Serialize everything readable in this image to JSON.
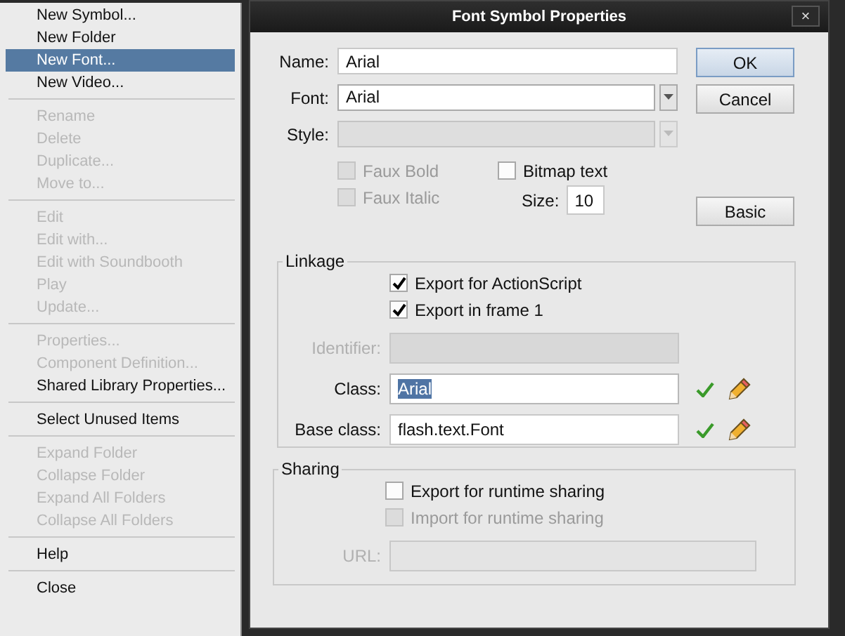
{
  "menu": {
    "items": [
      {
        "kind": "item",
        "label": "New Symbol...",
        "disabled": false,
        "selected": false
      },
      {
        "kind": "item",
        "label": "New Folder",
        "disabled": false,
        "selected": false
      },
      {
        "kind": "item",
        "label": "New Font...",
        "disabled": false,
        "selected": true
      },
      {
        "kind": "item",
        "label": "New Video...",
        "disabled": false,
        "selected": false
      },
      {
        "kind": "separator"
      },
      {
        "kind": "item",
        "label": "Rename",
        "disabled": true,
        "selected": false
      },
      {
        "kind": "item",
        "label": "Delete",
        "disabled": true,
        "selected": false
      },
      {
        "kind": "item",
        "label": "Duplicate...",
        "disabled": true,
        "selected": false
      },
      {
        "kind": "item",
        "label": "Move to...",
        "disabled": true,
        "selected": false
      },
      {
        "kind": "separator"
      },
      {
        "kind": "item",
        "label": "Edit",
        "disabled": true,
        "selected": false
      },
      {
        "kind": "item",
        "label": "Edit with...",
        "disabled": true,
        "selected": false
      },
      {
        "kind": "item",
        "label": "Edit with Soundbooth",
        "disabled": true,
        "selected": false
      },
      {
        "kind": "item",
        "label": "Play",
        "disabled": true,
        "selected": false
      },
      {
        "kind": "item",
        "label": "Update...",
        "disabled": true,
        "selected": false
      },
      {
        "kind": "separator"
      },
      {
        "kind": "item",
        "label": "Properties...",
        "disabled": true,
        "selected": false
      },
      {
        "kind": "item",
        "label": "Component Definition...",
        "disabled": true,
        "selected": false
      },
      {
        "kind": "item",
        "label": "Shared Library Properties...",
        "disabled": false,
        "selected": false
      },
      {
        "kind": "separator"
      },
      {
        "kind": "item",
        "label": "Select Unused Items",
        "disabled": false,
        "selected": false
      },
      {
        "kind": "separator"
      },
      {
        "kind": "item",
        "label": "Expand Folder",
        "disabled": true,
        "selected": false
      },
      {
        "kind": "item",
        "label": "Collapse Folder",
        "disabled": true,
        "selected": false
      },
      {
        "kind": "item",
        "label": "Expand All Folders",
        "disabled": true,
        "selected": false
      },
      {
        "kind": "item",
        "label": "Collapse All Folders",
        "disabled": true,
        "selected": false
      },
      {
        "kind": "separator"
      },
      {
        "kind": "item",
        "label": "Help",
        "disabled": false,
        "selected": false
      },
      {
        "kind": "separator"
      },
      {
        "kind": "item",
        "label": "Close",
        "disabled": false,
        "selected": false
      }
    ]
  },
  "dialog": {
    "title": "Font Symbol Properties",
    "close": "×",
    "name": {
      "label": "Name:",
      "value": "Arial"
    },
    "font": {
      "label": "Font:",
      "value": "Arial",
      "disabled": false
    },
    "style": {
      "label": "Style:",
      "disabled": true
    },
    "faux_bold": {
      "label": "Faux Bold",
      "checked": false,
      "disabled": true
    },
    "faux_italic": {
      "label": "Faux Italic",
      "checked": false,
      "disabled": true
    },
    "bitmap_text": {
      "label": "Bitmap text",
      "checked": false,
      "disabled": false
    },
    "size": {
      "label": "Size:",
      "value": "10"
    },
    "buttons": [
      {
        "label": "OK",
        "default": true
      },
      {
        "label": "Cancel",
        "default": false
      },
      {
        "label": "Basic",
        "default": false
      }
    ],
    "linkage": {
      "legend": "Linkage",
      "checkboxes": [
        {
          "label": "Export for ActionScript",
          "checked": true,
          "disabled": false
        },
        {
          "label": "Export in frame 1",
          "checked": true,
          "disabled": false
        }
      ],
      "fields": [
        {
          "label": "Identifier:",
          "disabled": true,
          "highlighted": false
        },
        {
          "label": "Class:",
          "value": "Arial",
          "disabled": false,
          "highlighted": true,
          "tools": true
        },
        {
          "label": "Base class:",
          "value": "flash.text.Font",
          "disabled": false,
          "highlighted": false,
          "tools": true
        }
      ]
    },
    "sharing": {
      "legend": "Sharing",
      "checkboxes": [
        {
          "label": "Export for runtime sharing",
          "checked": false,
          "disabled": false
        },
        {
          "label": "Import for runtime sharing",
          "checked": false,
          "disabled": true
        }
      ],
      "url": {
        "label": "URL:",
        "disabled": true
      }
    }
  }
}
